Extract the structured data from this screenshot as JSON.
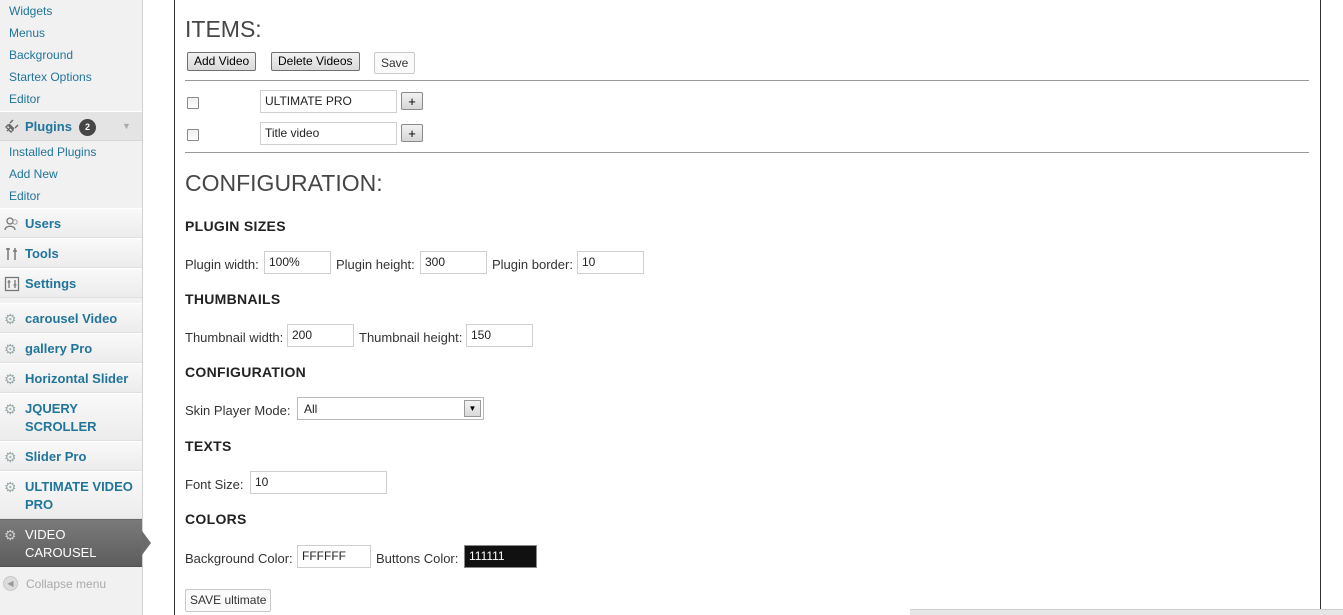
{
  "sidebar": {
    "appearance_subitems": [
      "Widgets",
      "Menus",
      "Background",
      "Startex Options",
      "Editor"
    ],
    "plugins": {
      "label": "Plugins",
      "badge": "2",
      "icon": "plug-icon"
    },
    "plugin_subitems": [
      "Installed Plugins",
      "Add New",
      "Editor"
    ],
    "menu": [
      {
        "label": "Users",
        "icon": "users-icon"
      },
      {
        "label": "Tools",
        "icon": "tools-icon"
      },
      {
        "label": "Settings",
        "icon": "settings-icon"
      }
    ],
    "custom_menu": [
      {
        "label": "carousel Video",
        "icon": "gear-icon"
      },
      {
        "label": "gallery Pro",
        "icon": "gear-icon"
      },
      {
        "label": "Horizontal Slider",
        "icon": "gear-icon"
      },
      {
        "label_line1": "JQUERY",
        "label_line2": "SCROLLER",
        "icon": "gear-icon"
      },
      {
        "label": "Slider Pro",
        "icon": "gear-icon"
      },
      {
        "label_line1": "ULTIMATE VIDEO",
        "label_line2": "PRO",
        "icon": "gear-icon"
      },
      {
        "label_line1": "VIDEO",
        "label_line2": "CAROUSEL",
        "icon": "gear-icon",
        "current": true
      }
    ],
    "collapse_label": "Collapse menu"
  },
  "items": {
    "heading": "ITEMS:",
    "add_video_label": "Add Video",
    "delete_videos_label": "Delete Videos",
    "save_label": "Save",
    "rows": [
      {
        "title": "ULTIMATE PRO",
        "expand_label": "+"
      },
      {
        "title": "Title video",
        "expand_label": "+"
      }
    ]
  },
  "configuration": {
    "heading": "CONFIGURATION:",
    "plugin_sizes": {
      "heading": "PLUGIN SIZES",
      "width_label": "Plugin width:",
      "width_value": "100%",
      "height_label": "Plugin height:",
      "height_value": "300",
      "border_label": "Plugin border:",
      "border_value": "10"
    },
    "thumbnails": {
      "heading": "THUMBNAILS",
      "width_label": "Thumbnail width:",
      "width_value": "200",
      "height_label": "Thumbnail height:",
      "height_value": "150"
    },
    "config": {
      "heading": "CONFIGURATION",
      "skin_label": "Skin Player Mode:",
      "skin_value": "All"
    },
    "texts": {
      "heading": "TEXTS",
      "font_size_label": "Font Size:",
      "font_size_value": "10"
    },
    "colors": {
      "heading": "COLORS",
      "bg_label": "Background Color:",
      "bg_value": "FFFFFF",
      "buttons_label": "Buttons Color:",
      "buttons_value": "111111"
    },
    "save_button_label": "SAVE ultimate"
  },
  "colors": {
    "link": "#21759b",
    "current_menu_bg": "#6b6b6b",
    "buttons_swatch": "#111111"
  }
}
